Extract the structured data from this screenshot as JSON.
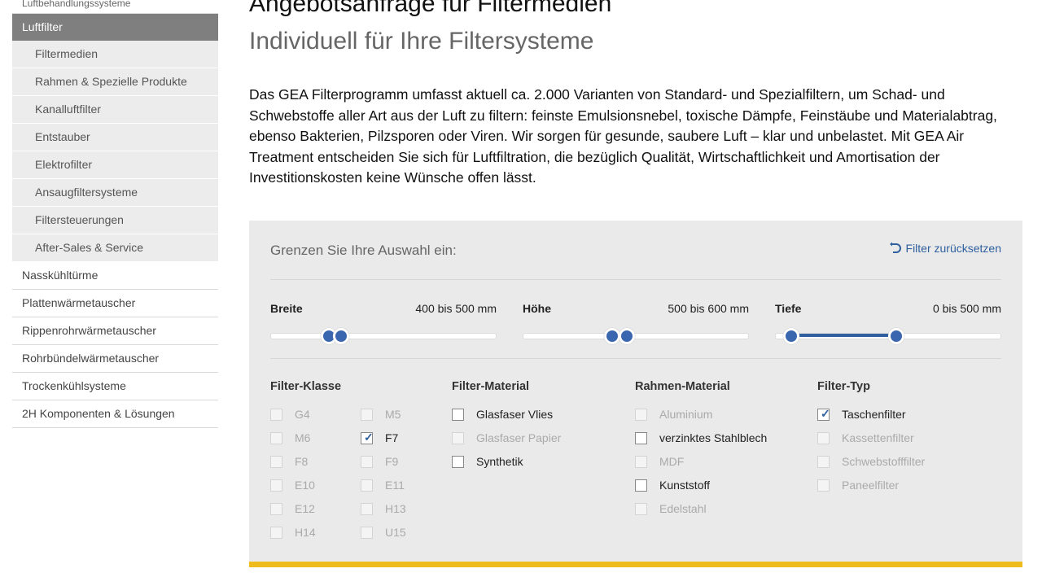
{
  "sidebar": {
    "top_item": "Luftbehandlungssysteme",
    "active": "Luftfilter",
    "subitems": [
      "Filtermedien",
      "Rahmen & Spezielle Produkte",
      "Kanalluftfilter",
      "Entstauber",
      "Elektrofilter",
      "Ansaugfiltersysteme",
      "Filtersteuerungen",
      "After-Sales & Service"
    ],
    "items": [
      "Nasskühltürme",
      "Plattenwärmetauscher",
      "Rippenrohrwärmetauscher",
      "Rohrbündelwärmetauscher",
      "Trockenkühlsysteme",
      "2H Komponenten & Lösungen"
    ]
  },
  "main": {
    "title": "Angebotsanfrage für Filtermedien",
    "subtitle": "Individuell für Ihre Filtersysteme",
    "intro": "Das GEA Filterprogramm umfasst aktuell ca. 2.000 Varianten von Standard- und Spezialfiltern, um Schad- und Schwebstoffe aller Art aus der Luft zu filtern: feinste Emulsionsnebel, toxische Dämpfe, Feinstäube und Materialabtrag, ebenso Bakterien, Pilzsporen oder Viren. Wir sorgen für gesunde, saubere Luft – klar und unbelastet. Mit GEA Air Treatment entscheiden Sie sich für Luftfiltration, die bezüglich Qualität, Wirtschaftlichkeit und Amortisation der Investitionskosten keine Wünsche offen lässt."
  },
  "filter": {
    "heading": "Grenzen Sie Ihre Auswahl ein:",
    "reset_label": "Filter zurücksetzen",
    "accent_color": "#2f5f9e",
    "bar_color": "#eebc1d",
    "sliders": [
      {
        "label": "Breite",
        "range": "400 bis 500 mm",
        "low": 0.2,
        "high": 0.26
      },
      {
        "label": "Höhe",
        "range": "500 bis 600 mm",
        "low": 0.35,
        "high": 0.42
      },
      {
        "label": "Tiefe",
        "range": "0 bis 500 mm",
        "low": 0.0,
        "high": 0.5
      }
    ],
    "groups": [
      {
        "title": "Filter-Klasse",
        "options": [
          {
            "label": "G4",
            "checked": false,
            "enabled": false
          },
          {
            "label": "M5",
            "checked": false,
            "enabled": false
          },
          {
            "label": "M6",
            "checked": false,
            "enabled": false
          },
          {
            "label": "F7",
            "checked": true,
            "enabled": true
          },
          {
            "label": "F8",
            "checked": false,
            "enabled": false
          },
          {
            "label": "F9",
            "checked": false,
            "enabled": false
          },
          {
            "label": "E10",
            "checked": false,
            "enabled": false
          },
          {
            "label": "E11",
            "checked": false,
            "enabled": false
          },
          {
            "label": "E12",
            "checked": false,
            "enabled": false
          },
          {
            "label": "H13",
            "checked": false,
            "enabled": false
          },
          {
            "label": "H14",
            "checked": false,
            "enabled": false
          },
          {
            "label": "U15",
            "checked": false,
            "enabled": false
          }
        ]
      },
      {
        "title": "Filter-Material",
        "options": [
          {
            "label": "Glasfaser Vlies",
            "checked": false,
            "enabled": true
          },
          {
            "label": "Glasfaser Papier",
            "checked": false,
            "enabled": false
          },
          {
            "label": "Synthetik",
            "checked": false,
            "enabled": true
          }
        ]
      },
      {
        "title": "Rahmen-Material",
        "options": [
          {
            "label": "Aluminium",
            "checked": false,
            "enabled": false
          },
          {
            "label": "verzinktes Stahlblech",
            "checked": false,
            "enabled": true
          },
          {
            "label": "MDF",
            "checked": false,
            "enabled": false
          },
          {
            "label": "Kunststoff",
            "checked": false,
            "enabled": true
          },
          {
            "label": "Edelstahl",
            "checked": false,
            "enabled": false
          }
        ]
      },
      {
        "title": "Filter-Typ",
        "options": [
          {
            "label": "Taschenfilter",
            "checked": true,
            "enabled": true
          },
          {
            "label": "Kassettenfilter",
            "checked": false,
            "enabled": false
          },
          {
            "label": "Schwebstofffilter",
            "checked": false,
            "enabled": false
          },
          {
            "label": "Paneelfilter",
            "checked": false,
            "enabled": false
          }
        ]
      }
    ]
  }
}
